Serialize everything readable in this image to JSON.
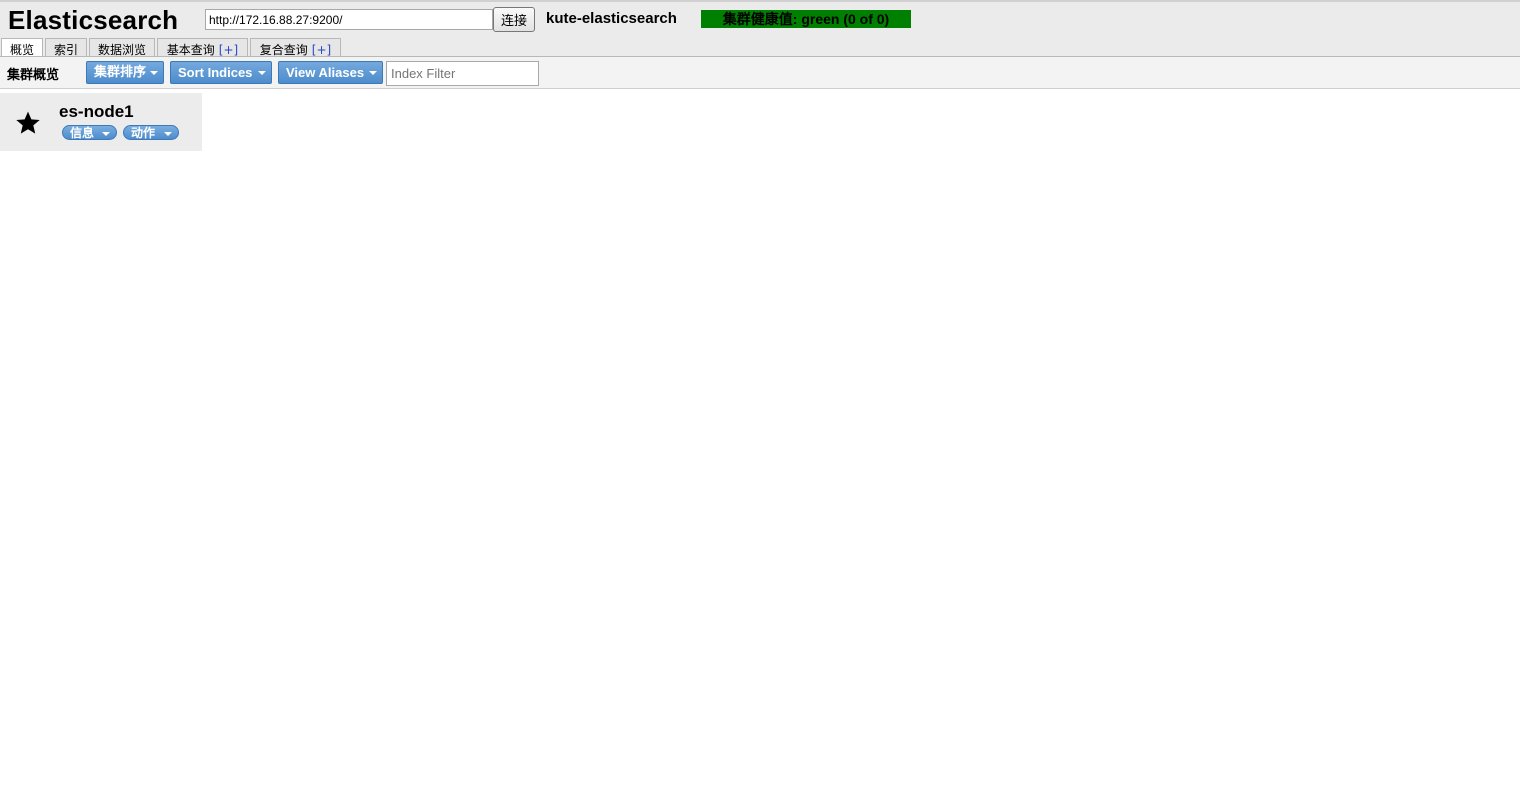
{
  "header": {
    "logo": "Elasticsearch",
    "url_value": "http://172.16.88.27:9200/",
    "connect_label": "连接",
    "cluster_name": "kute-elasticsearch",
    "health_text": "集群健康值: green (0 of 0)",
    "health_color": "#008000"
  },
  "tabs": [
    {
      "label": "概览",
      "plus": "",
      "active": true
    },
    {
      "label": "索引",
      "plus": "",
      "active": false
    },
    {
      "label": "数据浏览",
      "plus": "",
      "active": false
    },
    {
      "label": "基本查询",
      "plus": "[+]",
      "active": false
    },
    {
      "label": "复合查询",
      "plus": "[+]",
      "active": false
    }
  ],
  "toolbar": {
    "title": "集群概览",
    "sort_cluster_label": "集群排序",
    "sort_indices_label": "Sort Indices",
    "view_aliases_label": "View Aliases",
    "index_filter_placeholder": "Index Filter"
  },
  "node": {
    "name": "es-node1",
    "icon": "star-icon",
    "info_label": "信息",
    "actions_label": "动作"
  },
  "colors": {
    "accent_blue": "#4d8ccc",
    "header_bg": "#ebebeb"
  }
}
